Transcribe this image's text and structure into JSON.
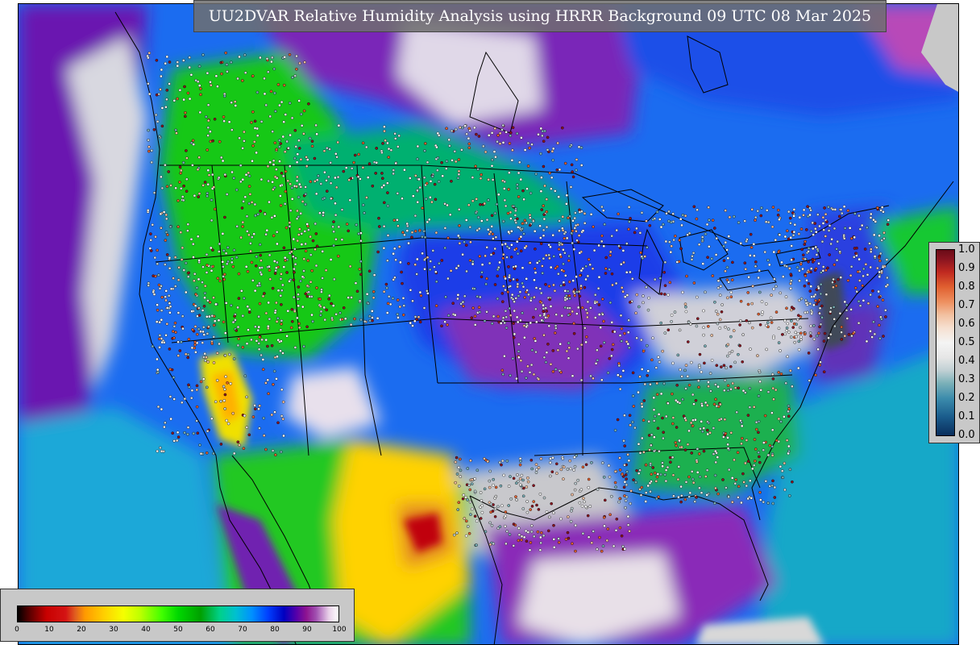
{
  "title": "UU2DVAR Relative Humidity Analysis using HRRR Background 09 UTC 08 Mar 2025",
  "colors": {
    "ocean": "#1b6cf0",
    "very_dry": "#c80000",
    "dry": "#ffd000",
    "moderate": "#00c800",
    "humid": "#00a0e0",
    "very_humid": "#5a00a8",
    "saturated": "#e8e0e8",
    "land_outside_domain": "#c8c8c8",
    "boundaries": "#000000"
  },
  "rh_colorbar": {
    "ticks": [
      "0",
      "10",
      "20",
      "30",
      "40",
      "50",
      "60",
      "70",
      "80",
      "90",
      "100"
    ]
  },
  "prob_colorbar": {
    "ticks": [
      "1.0",
      "0.9",
      "0.8",
      "0.7",
      "0.6",
      "0.5",
      "0.4",
      "0.3",
      "0.2",
      "0.1",
      "0.0"
    ]
  }
}
